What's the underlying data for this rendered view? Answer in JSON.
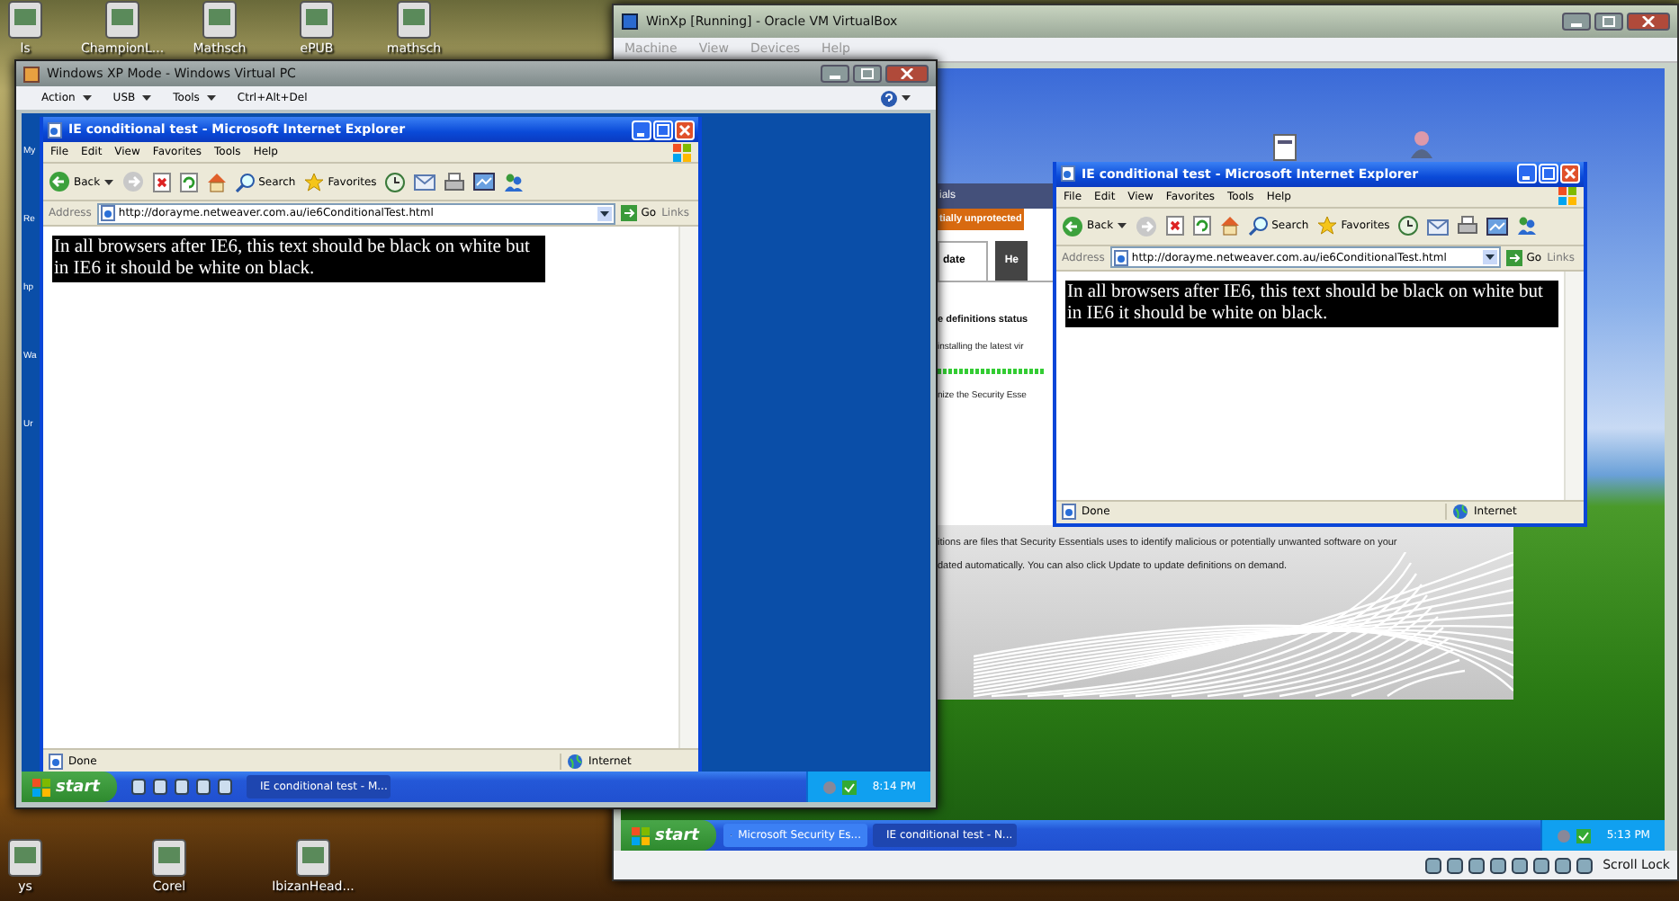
{
  "desktop_icons": [
    {
      "label": "ls"
    },
    {
      "label": "ChampionL..."
    },
    {
      "label": "Mathsch"
    },
    {
      "label": "ePUB"
    },
    {
      "label": "mathsch"
    }
  ],
  "desktop_bottom_icons": [
    {
      "label": "ys"
    },
    {
      "label": "Corel"
    },
    {
      "label": "IbizanHead..."
    }
  ],
  "virtualbox": {
    "title": "WinXp [Running] - Oracle VM VirtualBox",
    "menu": [
      "Machine",
      "View",
      "Devices",
      "Help"
    ],
    "security_window": {
      "header": "ials",
      "banner": "tially unprotected",
      "tabs": [
        {
          "label": "date",
          "selected": true
        },
        {
          "label": "He",
          "selected": false
        }
      ],
      "heading": "e definitions status",
      "lines": [
        "installing the latest vir",
        "nize the Security Esse"
      ],
      "paragraphs": [
        "itions are files that Security Essentials uses to identify malicious or potentially unwanted software on your",
        "dated automatically. You can also click Update to update definitions on demand."
      ]
    },
    "ie": {
      "title": "IE conditional test - Microsoft Internet Explorer",
      "menu": [
        "File",
        "Edit",
        "View",
        "Favorites",
        "Tools",
        "Help"
      ],
      "back": "Back",
      "search": "Search",
      "favorites": "Favorites",
      "address_label": "Address",
      "url": "http://dorayme.netweaver.com.au/ie6ConditionalTest.html",
      "go": "Go",
      "links": "Links",
      "content": "In all browsers after IE6, this text should be black on white but in IE6 it should be white on black.",
      "status": "Done",
      "zone": "Internet"
    },
    "taskbar": {
      "start": "start",
      "tasks": [
        {
          "label": "Microsoft Security Es...",
          "selected": false
        },
        {
          "label": "IE conditional test - N...",
          "selected": true
        }
      ],
      "clock": "5:13 PM"
    },
    "status_bar": {
      "text": "Scroll Lock"
    }
  },
  "xp_mode": {
    "title": "Windows XP Mode - Windows Virtual PC",
    "toolbar": [
      {
        "label": "Action",
        "dropdown": true
      },
      {
        "label": "USB",
        "dropdown": true
      },
      {
        "label": "Tools",
        "dropdown": true
      },
      {
        "label": "Ctrl+Alt+Del",
        "dropdown": false
      }
    ],
    "desktop_labels": [
      "My",
      "Re",
      "hp",
      "Wa",
      "Ur"
    ],
    "ie": {
      "title": "IE conditional test - Microsoft Internet Explorer",
      "menu": [
        "File",
        "Edit",
        "View",
        "Favorites",
        "Tools",
        "Help"
      ],
      "back": "Back",
      "search": "Search",
      "favorites": "Favorites",
      "address_label": "Address",
      "url": "http://dorayme.netweaver.com.au/ie6ConditionalTest.html",
      "go": "Go",
      "links": "Links",
      "content": "In all browsers after IE6, this text should be black on white but in IE6 it should be white on black.",
      "status": "Done",
      "zone": "Internet"
    },
    "taskbar": {
      "start": "start",
      "tasks": [
        {
          "label": "IE conditional test - M...",
          "selected": true
        }
      ],
      "clock": "8:14 PM"
    }
  }
}
